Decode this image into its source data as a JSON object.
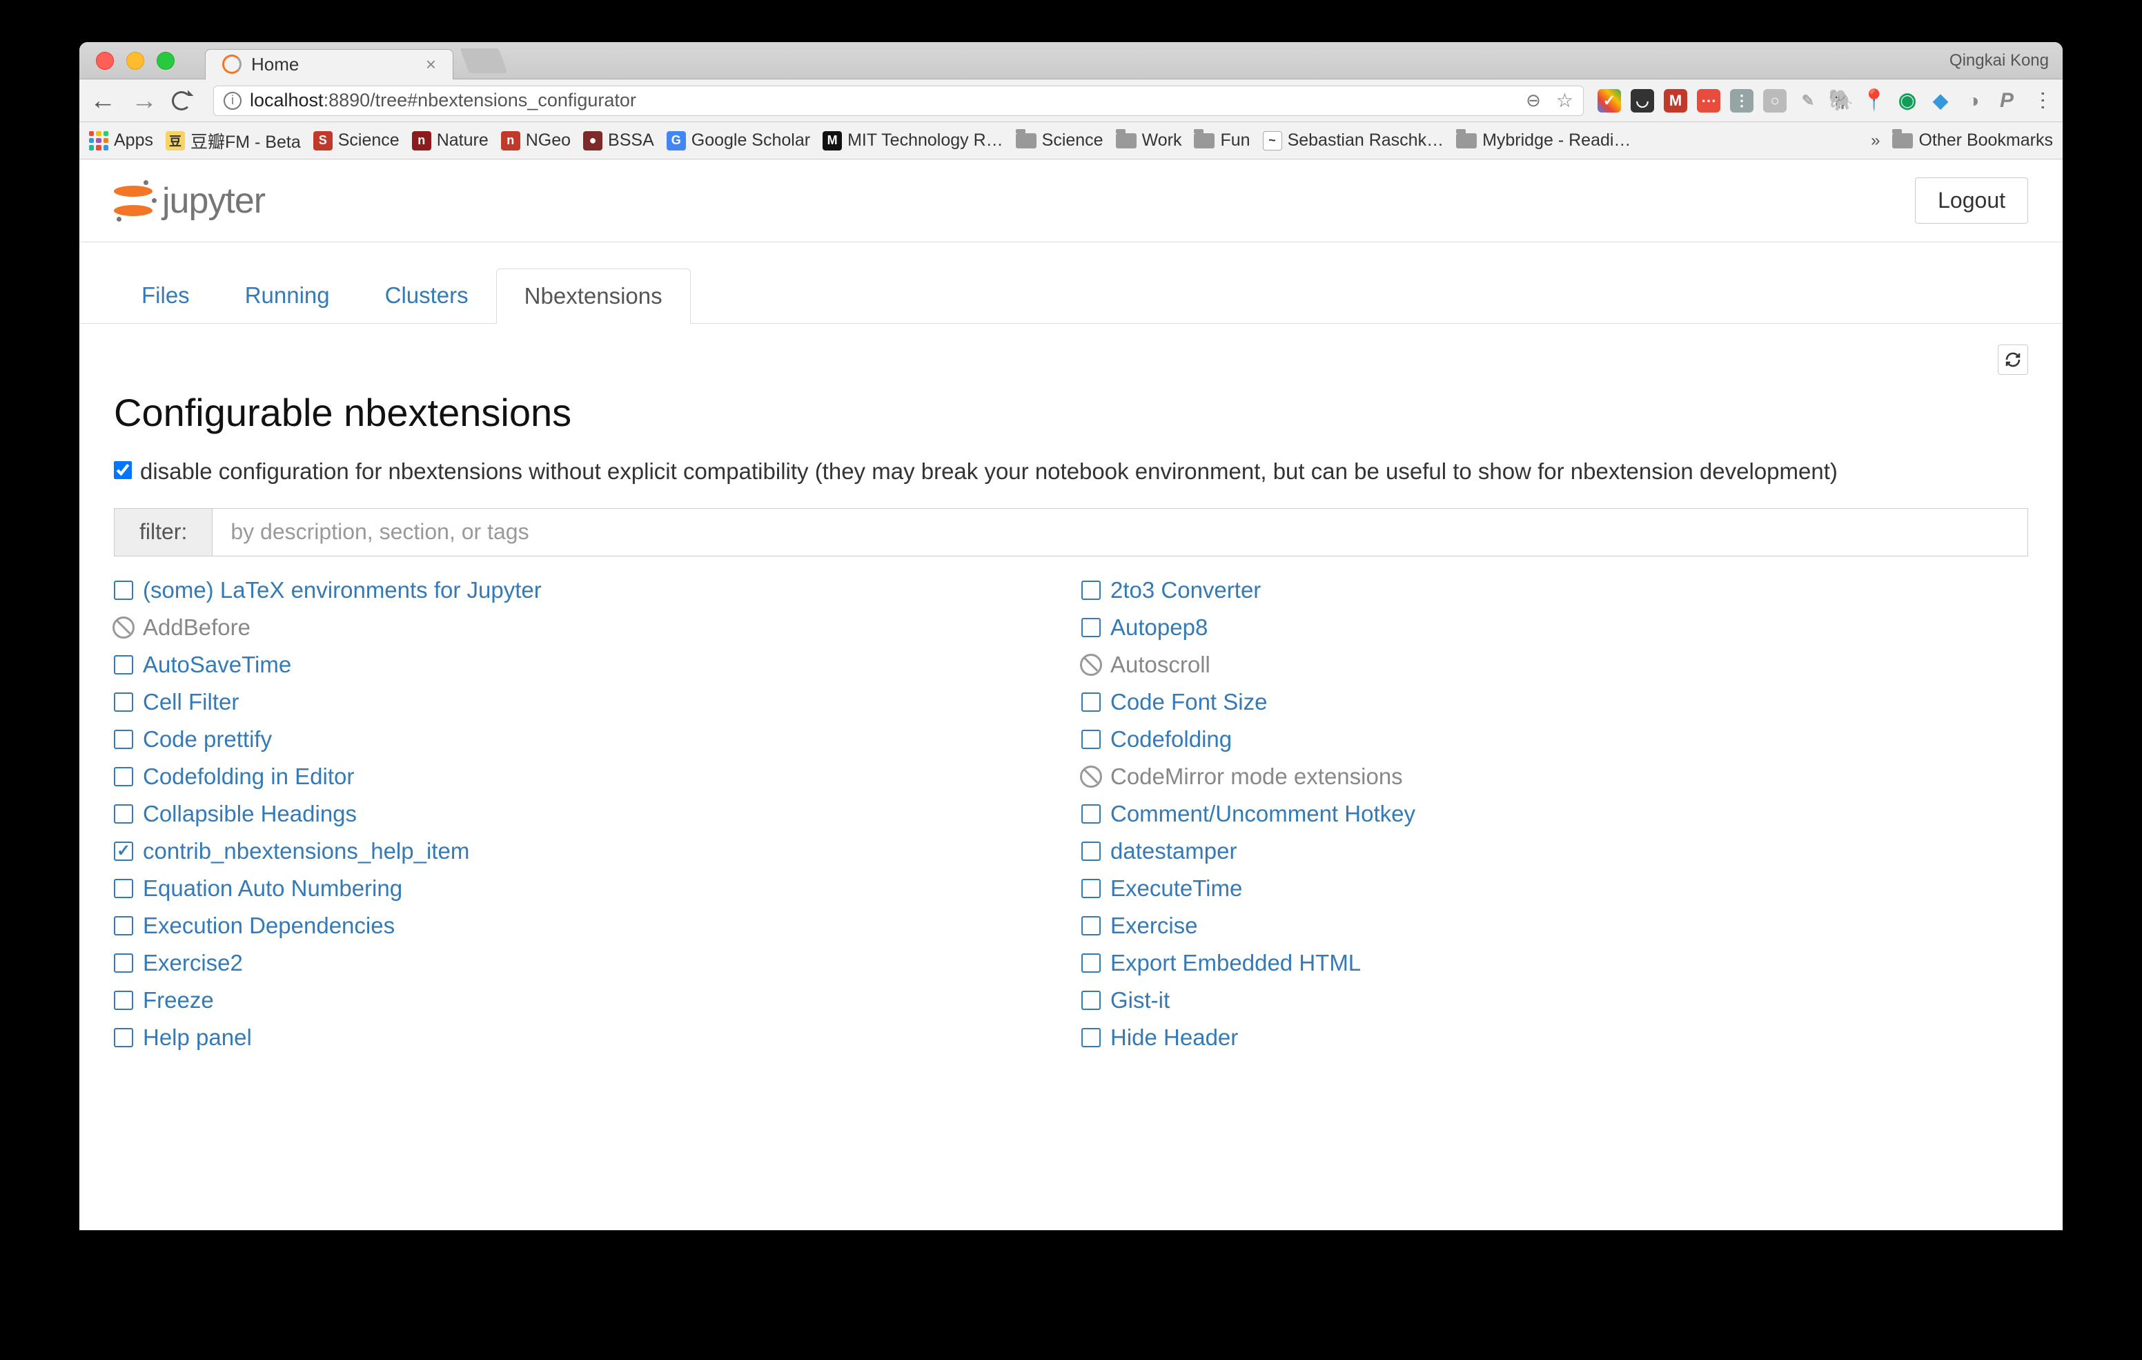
{
  "browser": {
    "tab_title": "Home",
    "profile_name": "Qingkai Kong",
    "url_host": "localhost",
    "url_path": ":8890/tree#nbextensions_configurator"
  },
  "bookmarks": {
    "apps": "Apps",
    "items": [
      "豆瓣FM - Beta",
      "Science",
      "Nature",
      "NGeo",
      "BSSA",
      "Google Scholar",
      "MIT Technology R…",
      "Science",
      "Work",
      "Fun",
      "Sebastian Raschk…",
      "Mybridge - Readi…"
    ],
    "other": "Other Bookmarks",
    "overflow": "»"
  },
  "jupyter": {
    "logo_text": "jupyter",
    "logout": "Logout",
    "tabs": [
      "Files",
      "Running",
      "Clusters",
      "Nbextensions"
    ],
    "active_tab": 3,
    "page_title": "Configurable nbextensions",
    "compat_text": "disable configuration for nbextensions without explicit compatibility (they may break your notebook environment, but can be useful to show for nbextension development)",
    "compat_checked": true,
    "filter_label": "filter:",
    "filter_placeholder": "by description, section, or tags",
    "extensions": [
      {
        "label": "(some) LaTeX environments for Jupyter",
        "state": "unchecked"
      },
      {
        "label": "2to3 Converter",
        "state": "unchecked"
      },
      {
        "label": "AddBefore",
        "state": "disabled"
      },
      {
        "label": "Autopep8",
        "state": "unchecked"
      },
      {
        "label": "AutoSaveTime",
        "state": "unchecked"
      },
      {
        "label": "Autoscroll",
        "state": "disabled"
      },
      {
        "label": "Cell Filter",
        "state": "unchecked"
      },
      {
        "label": "Code Font Size",
        "state": "unchecked"
      },
      {
        "label": "Code prettify",
        "state": "unchecked"
      },
      {
        "label": "Codefolding",
        "state": "unchecked"
      },
      {
        "label": "Codefolding in Editor",
        "state": "unchecked"
      },
      {
        "label": "CodeMirror mode extensions",
        "state": "disabled"
      },
      {
        "label": "Collapsible Headings",
        "state": "unchecked"
      },
      {
        "label": "Comment/Uncomment Hotkey",
        "state": "unchecked"
      },
      {
        "label": "contrib_nbextensions_help_item",
        "state": "checked"
      },
      {
        "label": "datestamper",
        "state": "unchecked"
      },
      {
        "label": "Equation Auto Numbering",
        "state": "unchecked"
      },
      {
        "label": "ExecuteTime",
        "state": "unchecked"
      },
      {
        "label": "Execution Dependencies",
        "state": "unchecked"
      },
      {
        "label": "Exercise",
        "state": "unchecked"
      },
      {
        "label": "Exercise2",
        "state": "unchecked"
      },
      {
        "label": "Export Embedded HTML",
        "state": "unchecked"
      },
      {
        "label": "Freeze",
        "state": "unchecked"
      },
      {
        "label": "Gist-it",
        "state": "unchecked"
      },
      {
        "label": "Help panel",
        "state": "unchecked"
      },
      {
        "label": "Hide Header",
        "state": "unchecked"
      }
    ]
  }
}
